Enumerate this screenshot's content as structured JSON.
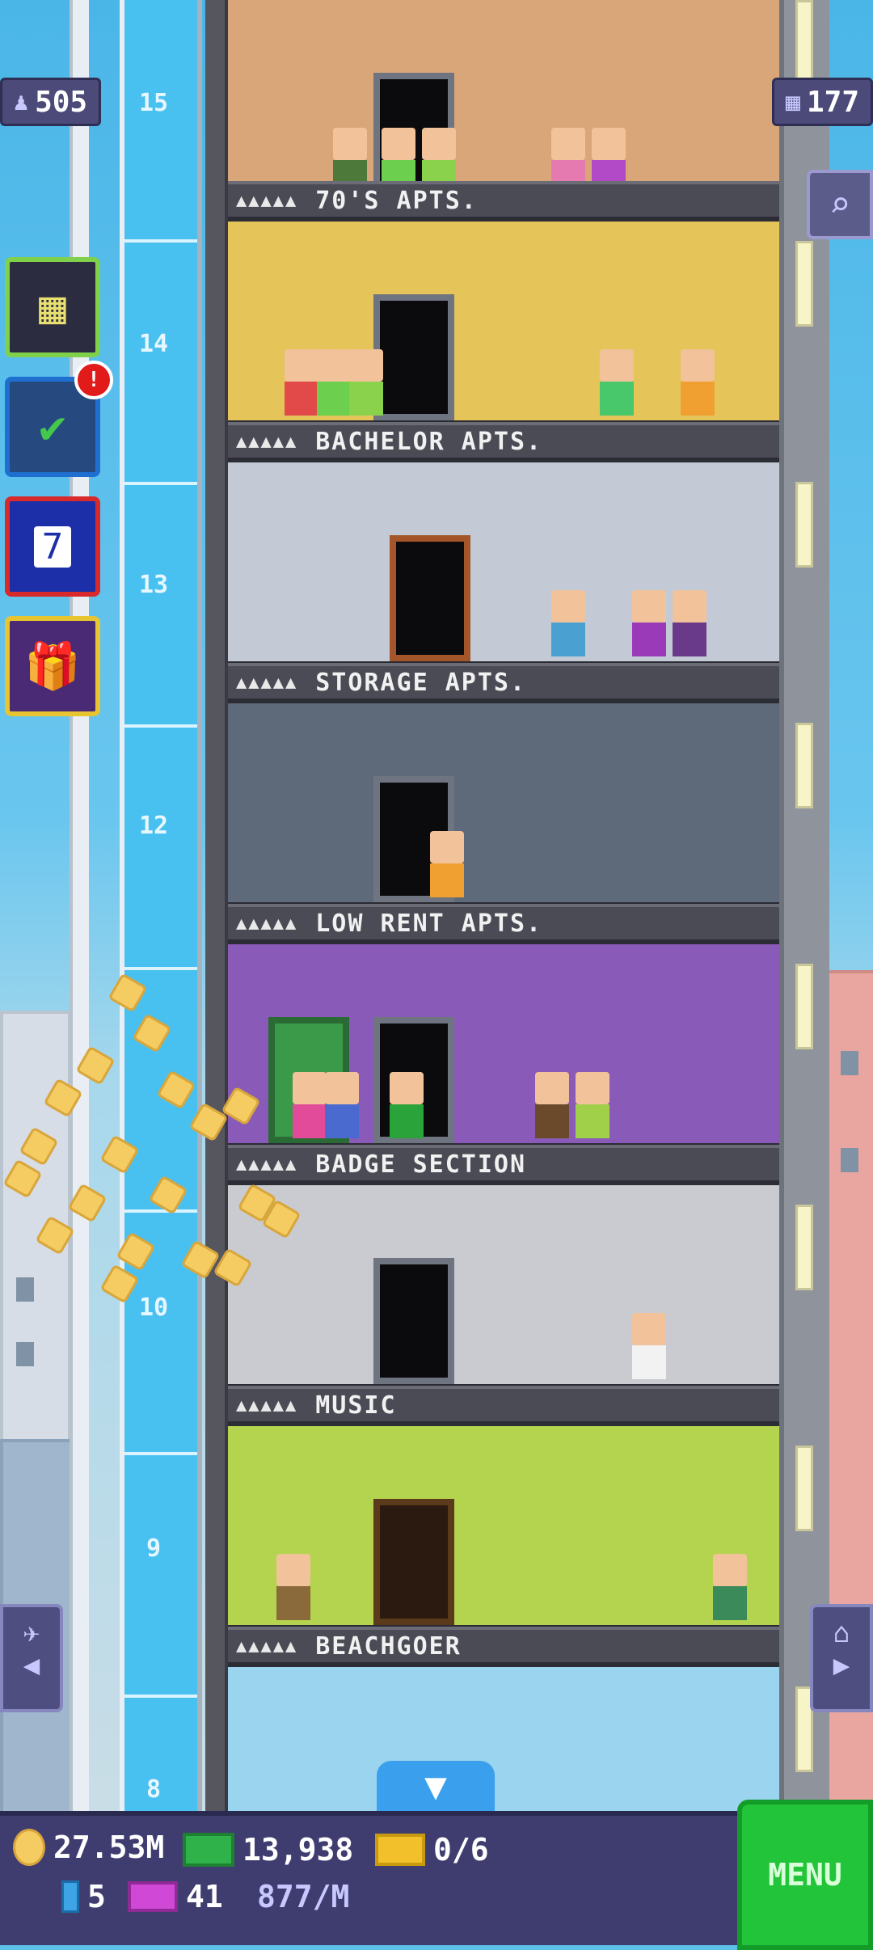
{
  "top_counters": {
    "population": "505",
    "population_icon": "person-icon",
    "floors": "177",
    "floors_icon": "building-grid-icon"
  },
  "shaft_floor_numbers": [
    "15",
    "14",
    "13",
    "12",
    "10",
    "9",
    "8"
  ],
  "floors": [
    {
      "label": "70'S APTS.",
      "stars": "▲▲▲▲▲",
      "wall": "#d9a67a"
    },
    {
      "label": "BACHELOR APTS.",
      "stars": "▲▲▲▲▲",
      "wall": "#e5c45a"
    },
    {
      "label": "STORAGE APTS.",
      "stars": "▲▲▲▲▲",
      "wall": "#c3cad6"
    },
    {
      "label": "LOW RENT APTS.",
      "stars": "▲▲▲▲▲",
      "wall": "#5e6a7a"
    },
    {
      "label": "BADGE SECTION",
      "stars": "▲▲▲▲▲",
      "wall": "#8a5ab8"
    },
    {
      "label": "MUSIC",
      "stars": "▲▲▲▲▲",
      "wall": "#c9cbd0"
    },
    {
      "label": "BEACHGOER",
      "stars": "▲▲▲▲▲",
      "wall": "#b4d34e"
    }
  ],
  "bottom_floor_wall": "#9ad4ee",
  "side_buttons": {
    "building_icon": "building-icon",
    "missions_icon": "checklist-icon",
    "missions_badge": "!",
    "calendar_icon": "calendar-icon",
    "calendar_day": "7",
    "gift_icon": "gift-icon"
  },
  "nav": {
    "search_icon": "magnifier-icon",
    "lobby_icon": "elevator-person-icon",
    "top_floor_icon": "home-icon",
    "scroll_down_icon": "chevron-down-icon"
  },
  "hud": {
    "coins": "27.53M",
    "bux": "13,938",
    "tickets": "0/6",
    "cells": "5",
    "vip": "41",
    "income": "877/M",
    "menu_label": "MENU"
  },
  "colors": {
    "hud_bg": "#3f3d70",
    "menu_green": "#22c43a",
    "shaft_blue": "#48c0f0",
    "coin_gold": "#f4cc62"
  }
}
